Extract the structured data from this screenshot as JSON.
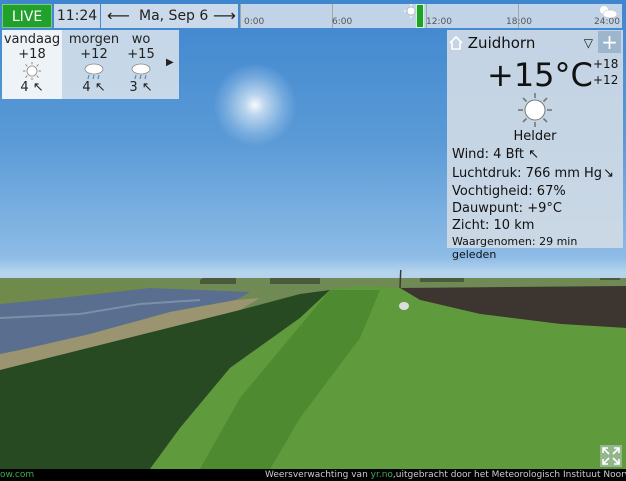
{
  "topbar": {
    "live_label": "LIVE",
    "time": "11:24",
    "date": "Ma, Sep 6",
    "timeline_ticks": [
      "0:00",
      "6:00",
      "12:00",
      "18:00",
      "24:00"
    ]
  },
  "forecast": {
    "days": [
      {
        "name": "vandaag",
        "temp": "+18",
        "icon": "sun-icon",
        "wind": "4"
      },
      {
        "name": "morgen",
        "temp": "+12",
        "icon": "rain-cloud-icon",
        "wind": "4"
      },
      {
        "name": "wo",
        "temp": "+15",
        "icon": "rain-cloud-icon",
        "wind": "3"
      }
    ]
  },
  "panel": {
    "location": "Zuidhorn",
    "temperature": "+15°C",
    "high": "+18",
    "low": "+12",
    "condition": "Helder",
    "wind": "Wind:  4 Bft",
    "pressure": "Luchtdruk:  766 mm Hg",
    "humidity": "Vochtigheid:  67%",
    "dewpoint": "Dauwpunt:  +9°C",
    "visibility": "Zicht:  10 km",
    "observed": "Waargenomen:  29 min geleden"
  },
  "footer": {
    "site": "ow.com",
    "credit_prefix": "Weersverwachting van ",
    "credit_link": "yr.no",
    "credit_suffix": ",uitgebracht door het Meteorologisch Instituut Noorwegen en h"
  },
  "colors": {
    "live": "#22a02c",
    "panel": "#d2dce6",
    "accent_green": "#3ab04a"
  }
}
